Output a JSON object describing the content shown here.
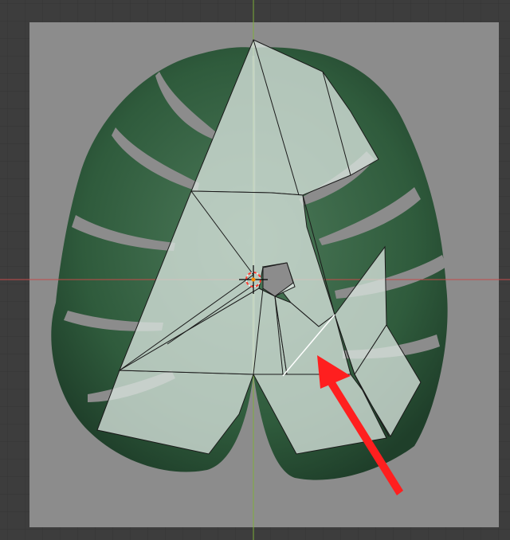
{
  "viewport": {
    "background_color": "#3d3d3d",
    "grid_color": "#353535",
    "x_axis_color": "#c44a4a",
    "y_axis_color": "#7fae3c",
    "image_plane_color": "#8c8c8c",
    "leaf_color": "#2f5b3c",
    "leaf_vein_color": "#8fa68a",
    "mesh_face_color": "#d7e3dc",
    "mesh_edge_color": "#1a1a1a",
    "selected_edge_color": "#ffffff",
    "annotation_arrow_color": "#ff1f1f",
    "cursor_color": "#ffffff",
    "cursor_ring_colors": [
      "#ffffff",
      "#ff3b2f"
    ]
  },
  "objects": {
    "reference_image": "monstera-leaf",
    "mesh": "leaf-cutout-mesh",
    "cursor": "3d-cursor",
    "annotation": "red-arrow"
  }
}
